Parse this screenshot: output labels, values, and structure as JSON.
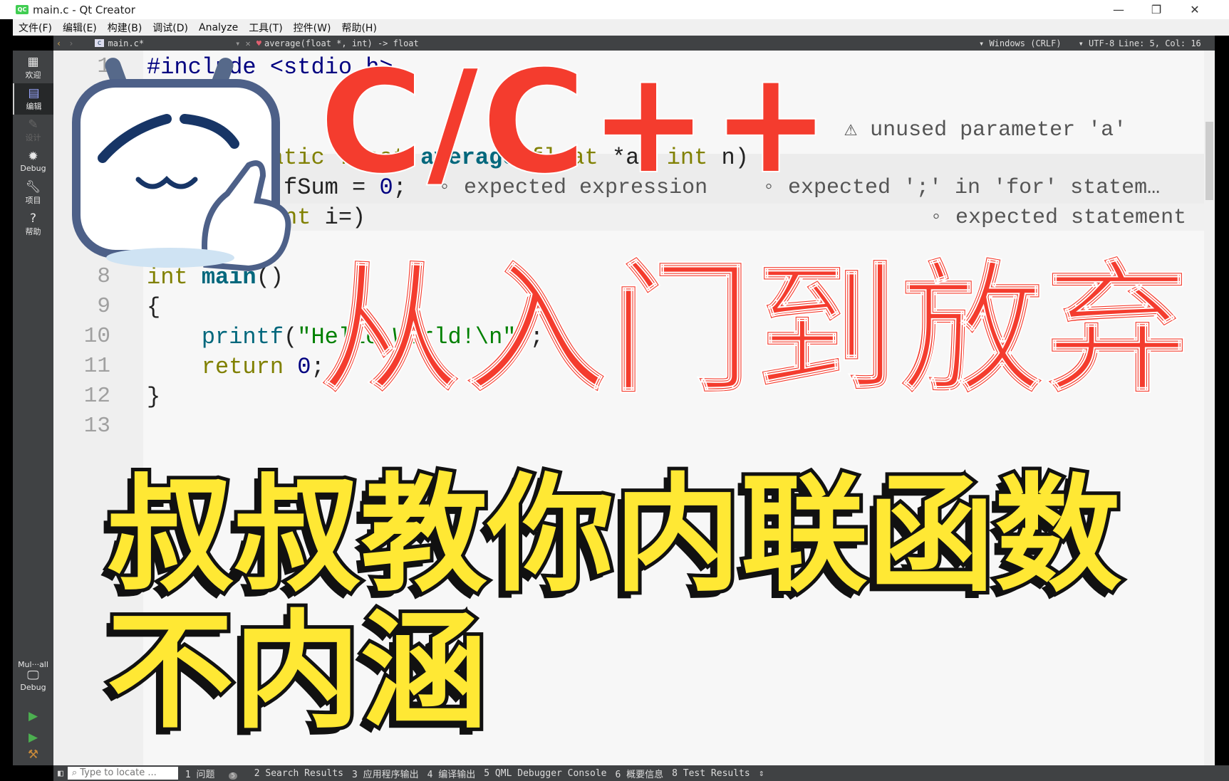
{
  "window": {
    "title": "main.c - Qt Creator",
    "logo": "QC",
    "minimize": "—",
    "maximize": "❐",
    "close": "✕"
  },
  "menu": [
    "文件(F)",
    "编辑(E)",
    "构建(B)",
    "调试(D)",
    "Analyze",
    "工具(T)",
    "控件(W)",
    "帮助(H)"
  ],
  "sidebar": {
    "items": [
      {
        "label": "欢迎",
        "icon": "grid-icon"
      },
      {
        "label": "编辑",
        "icon": "edit-doc-icon"
      },
      {
        "label": "设计",
        "icon": "pencil-icon"
      },
      {
        "label": "Debug",
        "icon": "bug-icon"
      },
      {
        "label": "项目",
        "icon": "wrench-icon"
      },
      {
        "label": "帮助",
        "icon": "help-icon"
      }
    ],
    "kit": "Mul···all",
    "target": "Debug"
  },
  "toolbar": {
    "file": "main.c*",
    "function": "average(float *, int) -> float",
    "line_ending": "Windows (CRLF)",
    "encoding": "UTF-8",
    "position": "Line: 5, Col: 16"
  },
  "editor": {
    "line_numbers": [
      "1",
      "8",
      "9",
      "10",
      "11",
      "12",
      "13"
    ],
    "annotations": {
      "unused": "unused parameter 'a'",
      "expected_expr": "expected expression",
      "expected_semi": "expected ';' in 'for' statem…",
      "expected_stmt": "expected statement"
    }
  },
  "status": {
    "locate_placeholder": "Type to locate ...",
    "tabs": [
      "1 问题",
      "2 Search Results",
      "3 应用程序输出",
      "4 编译输出",
      "5 QML Debugger Console",
      "6 概要信息",
      "8 Test Results"
    ],
    "issue_badge": "5"
  },
  "overlay": {
    "title1": "C/C++",
    "title2": "从入门到放弃",
    "subtitle1": "叔叔教你内联函数",
    "subtitle2": "不内涵",
    "accent_red": "#f43c2e",
    "accent_yellow": "#ffe834"
  }
}
